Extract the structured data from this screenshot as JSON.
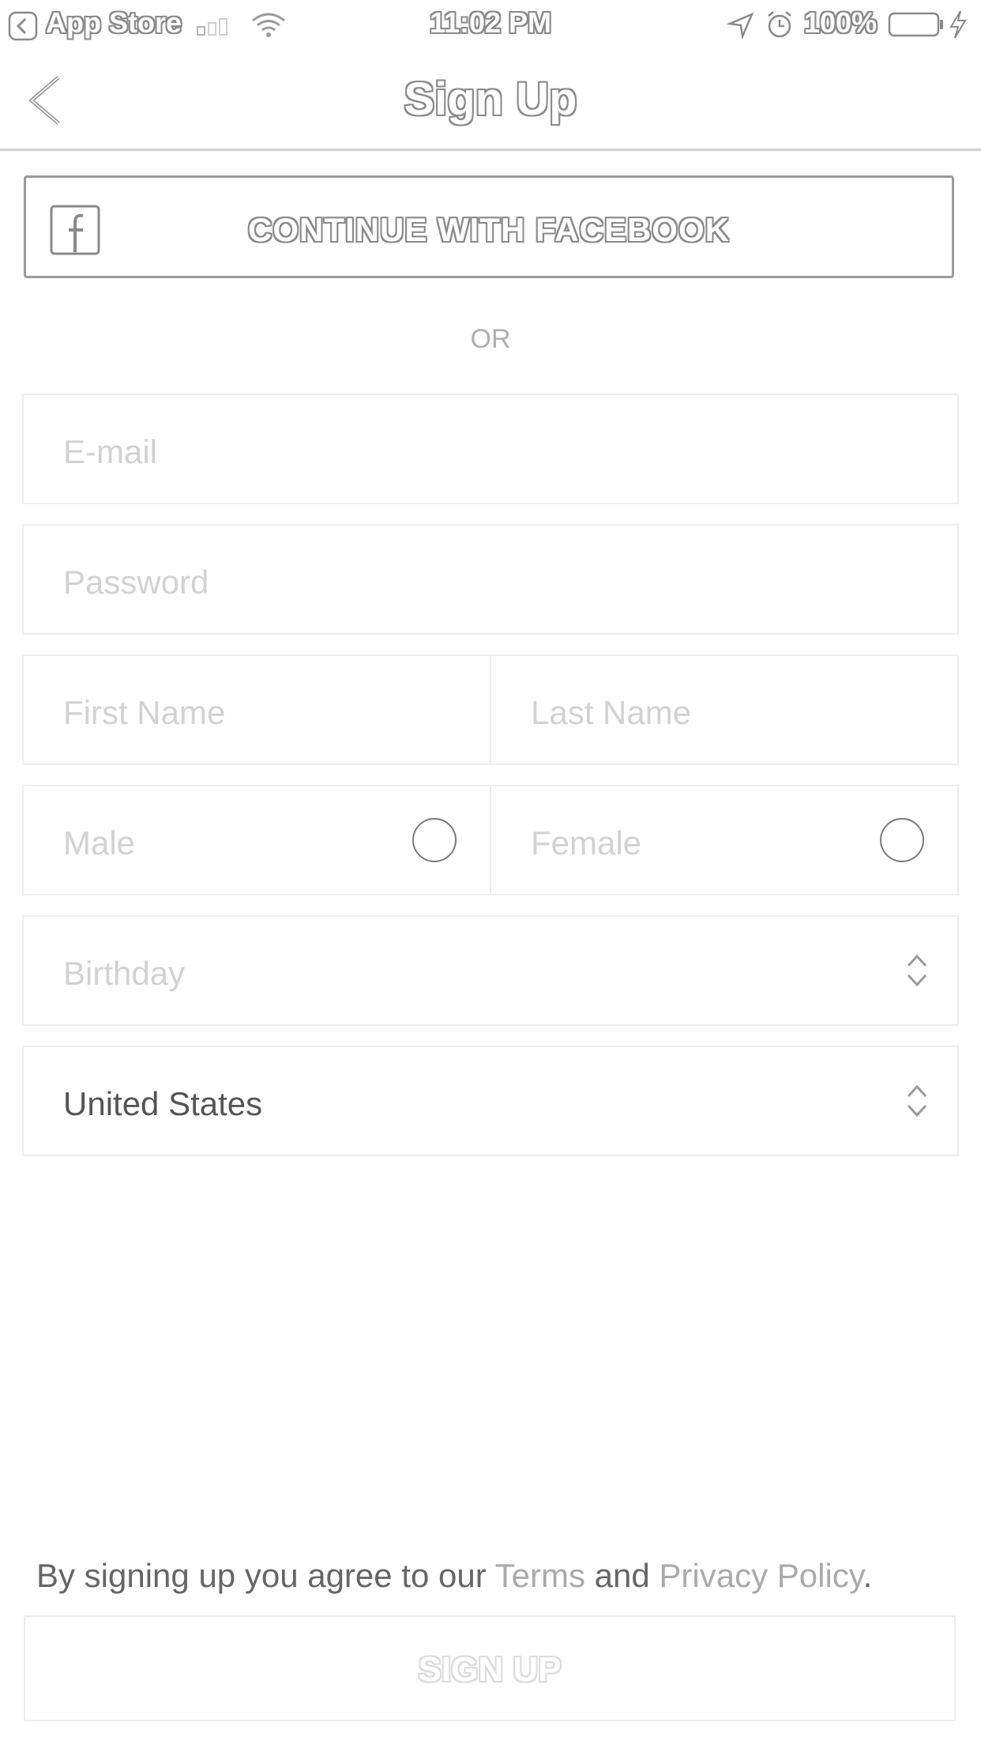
{
  "status_bar": {
    "back_app": "App Store",
    "time": "11:02 PM",
    "battery": "100%"
  },
  "nav": {
    "title": "Sign Up"
  },
  "facebook": {
    "label": "CONTINUE WITH FACEBOOK"
  },
  "divider": "OR",
  "form": {
    "email_placeholder": "E-mail",
    "password_placeholder": "Password",
    "first_name_placeholder": "First Name",
    "last_name_placeholder": "Last Name",
    "gender_male": "Male",
    "gender_female": "Female",
    "birthday_placeholder": "Birthday",
    "country_value": "United States"
  },
  "legal": {
    "prefix": "By signing up you agree to our ",
    "terms_link": "Terms",
    "middle": " and ",
    "privacy_link": "Privacy Policy",
    "suffix": "."
  },
  "submit": {
    "label": "SIGN UP"
  }
}
